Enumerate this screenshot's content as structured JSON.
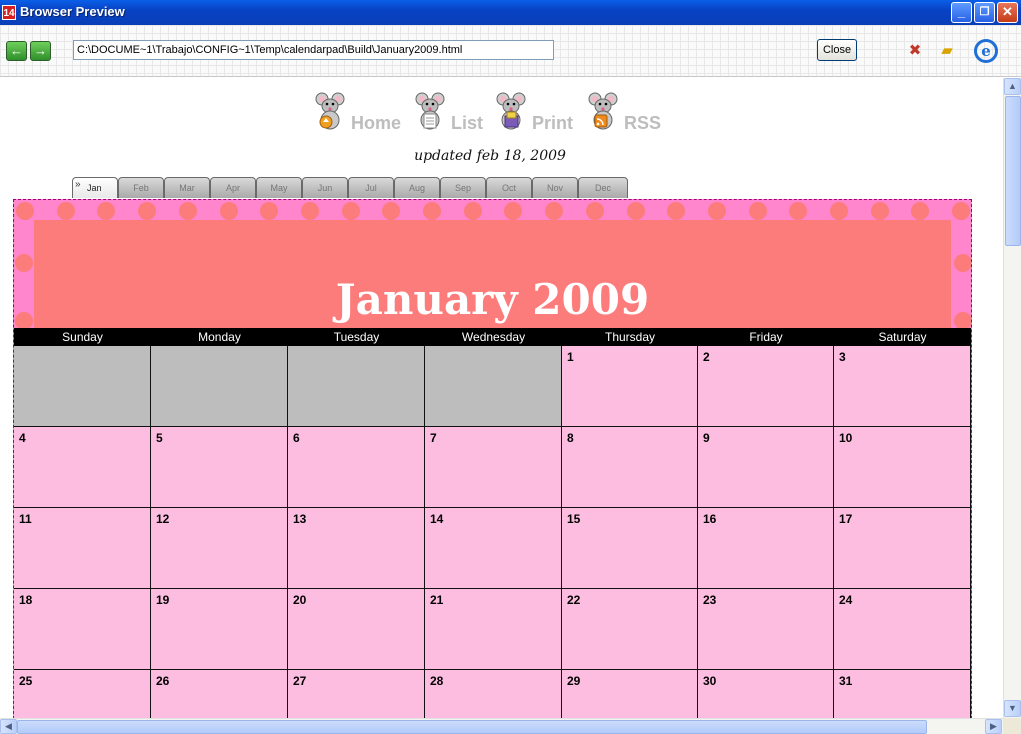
{
  "window": {
    "title": "Browser Preview",
    "app_icon_text": "14",
    "minimize_glyph": "_",
    "maximize_glyph": "❐",
    "close_glyph": "✕"
  },
  "toolbar": {
    "back_glyph": "←",
    "forward_glyph": "→",
    "url": "C:\\DOCUME~1\\Trabajo\\CONFIG~1\\Temp\\calendarpad\\Build\\January2009.html",
    "close_label": "Close",
    "icons": [
      "tools-icon",
      "folder-icon",
      "internet-explorer-icon"
    ]
  },
  "nav": {
    "items": [
      {
        "label": "Home",
        "icon": "mouse-home-icon"
      },
      {
        "label": "List",
        "icon": "mouse-list-icon"
      },
      {
        "label": "Print",
        "icon": "mouse-print-icon"
      },
      {
        "label": "RSS",
        "icon": "mouse-rss-icon"
      }
    ]
  },
  "updated": "updated feb 18, 2009",
  "tabs": {
    "arrow_glyph": "»",
    "months": [
      "Jan",
      "Feb",
      "Mar",
      "Apr",
      "May",
      "Jun",
      "Jul",
      "Aug",
      "Sep",
      "Oct",
      "Nov",
      "Dec"
    ],
    "active": "Jan"
  },
  "calendar": {
    "title": "January 2009",
    "weekdays": [
      "Sunday",
      "Monday",
      "Tuesday",
      "Wednesday",
      "Thursday",
      "Friday",
      "Saturday"
    ],
    "weeks": [
      [
        "",
        "",
        "",
        "",
        "1",
        "2",
        "3"
      ],
      [
        "4",
        "5",
        "6",
        "7",
        "8",
        "9",
        "10"
      ],
      [
        "11",
        "12",
        "13",
        "14",
        "15",
        "16",
        "17"
      ],
      [
        "18",
        "19",
        "20",
        "21",
        "22",
        "23",
        "24"
      ],
      [
        "25",
        "26",
        "27",
        "28",
        "29",
        "30",
        "31"
      ]
    ]
  },
  "colors": {
    "border_pink": "#ff85cc",
    "header_salmon": "#fc7b7b",
    "day_cell": "#fdbde1",
    "empty_cell": "#bdbdbd",
    "weekday_bar": "#000000"
  },
  "scrollbars": {
    "up_glyph": "▲",
    "down_glyph": "▼",
    "left_glyph": "◀",
    "right_glyph": "▶"
  }
}
